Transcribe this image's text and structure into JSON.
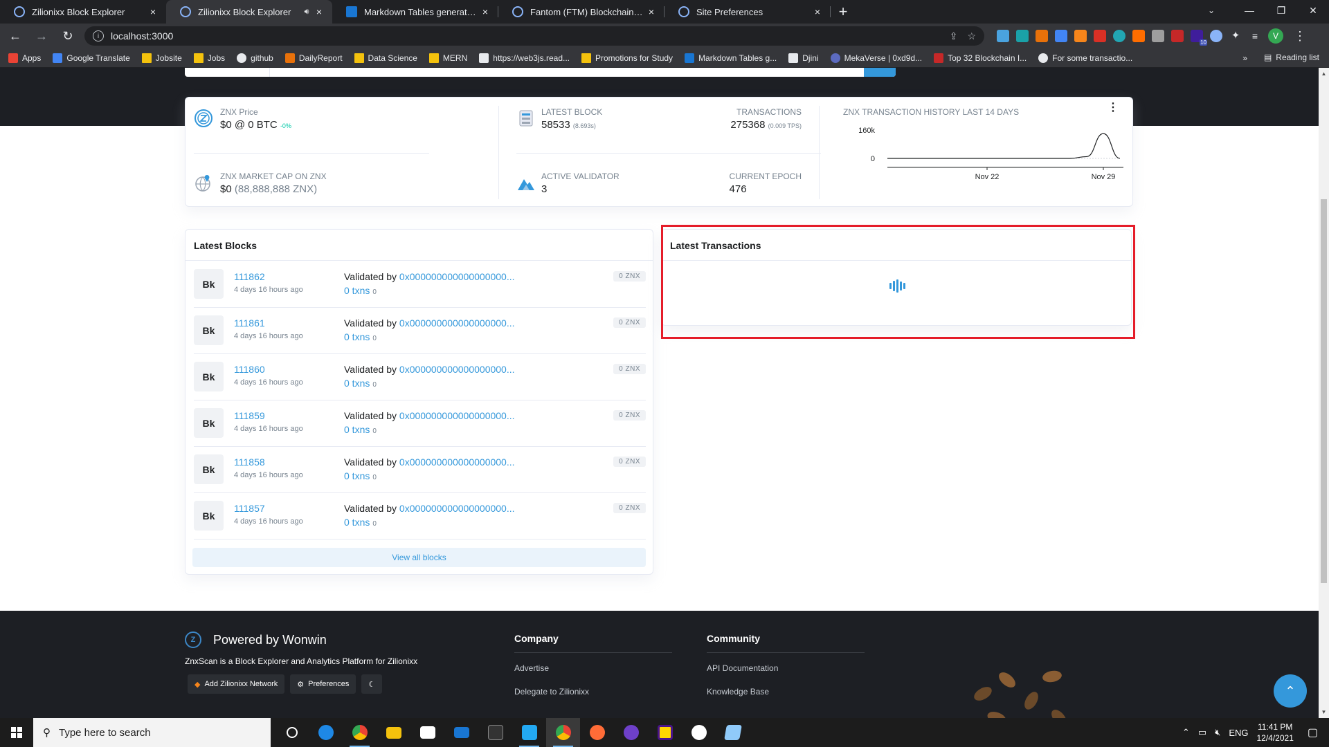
{
  "browser": {
    "tabs": [
      {
        "title": "Zilionixx Block Explorer",
        "active": false,
        "control": "×"
      },
      {
        "title": "Zilionixx Block Explorer",
        "active": true,
        "control": "×"
      },
      {
        "title": "Markdown Tables generator - Tal",
        "active": false,
        "control": "×"
      },
      {
        "title": "Fantom (FTM) Blockchain Explore",
        "active": false,
        "control": "×"
      },
      {
        "title": "Site Preferences",
        "active": false,
        "control": "×"
      }
    ],
    "new_tab": "+",
    "url": "localhost:3000",
    "profile_initial": "V",
    "extension_badge": "10",
    "bookmarks": [
      {
        "label": "Apps",
        "kind": "apps"
      },
      {
        "label": "Google Translate",
        "kind": "translate"
      },
      {
        "label": "Jobsite",
        "kind": "folder"
      },
      {
        "label": "Jobs",
        "kind": "folder"
      },
      {
        "label": "github",
        "kind": "github"
      },
      {
        "label": "DailyReport",
        "kind": "report"
      },
      {
        "label": "Data Science",
        "kind": "folder"
      },
      {
        "label": "MERN",
        "kind": "folder"
      },
      {
        "label": "https://web3js.read...",
        "kind": "doc"
      },
      {
        "label": "Promotions for Study",
        "kind": "folder"
      },
      {
        "label": "Markdown Tables g...",
        "kind": "table"
      },
      {
        "label": "Djini",
        "kind": "djini"
      },
      {
        "label": "MekaVerse | 0xd9d...",
        "kind": "meka"
      },
      {
        "label": "Top 32 Blockchain I...",
        "kind": "shield"
      },
      {
        "label": "For some transactio...",
        "kind": "github"
      }
    ],
    "bookmarks_more": "»",
    "reading_list": "Reading list"
  },
  "stats": {
    "price_label": "ZNX Price",
    "price_value": "$0 @ 0 BTC",
    "price_change": "-0%",
    "marketcap_label": "ZNX MARKET CAP ON ZNX",
    "marketcap_value": "$0",
    "marketcap_sub": "(88,888,888 ZNX)",
    "latest_block_label": "LATEST BLOCK",
    "latest_block_value": "58533",
    "latest_block_time": "(8.693s)",
    "transactions_label": "TRANSACTIONS",
    "transactions_value": "275368",
    "transactions_tps": "(0.009 TPS)",
    "validator_label": "ACTIVE VALIDATOR",
    "validator_value": "3",
    "epoch_label": "CURRENT EPOCH",
    "epoch_value": "476"
  },
  "chart_data": {
    "type": "line",
    "title": "ZNX TRANSACTION HISTORY LAST 14 DAYS",
    "menu_icon": "⋮",
    "y_ticks": [
      "160k",
      "0"
    ],
    "x_ticks": [
      "Nov 22",
      "Nov 29"
    ],
    "x": [
      "Nov 16",
      "Nov 17",
      "Nov 18",
      "Nov 19",
      "Nov 20",
      "Nov 21",
      "Nov 22",
      "Nov 23",
      "Nov 24",
      "Nov 25",
      "Nov 26",
      "Nov 27",
      "Nov 28",
      "Nov 29",
      "Nov 30"
    ],
    "values": [
      0,
      0,
      0,
      0,
      0,
      0,
      0,
      0,
      0,
      0,
      0,
      0,
      10000,
      140000,
      0
    ],
    "ylim": [
      0,
      160000
    ],
    "grid": false,
    "legend": "none"
  },
  "latest_blocks": {
    "title": "Latest Blocks",
    "badge": "Bk",
    "validated_prefix": "Validated by",
    "rows": [
      {
        "number": "111862",
        "age": "4 days 16 hours ago",
        "validator": "0x000000000000000000...",
        "txns": "0 txns",
        "tx_count": "0",
        "amount": "0 ZNX"
      },
      {
        "number": "111861",
        "age": "4 days 16 hours ago",
        "validator": "0x000000000000000000...",
        "txns": "0 txns",
        "tx_count": "0",
        "amount": "0 ZNX"
      },
      {
        "number": "111860",
        "age": "4 days 16 hours ago",
        "validator": "0x000000000000000000...",
        "txns": "0 txns",
        "tx_count": "0",
        "amount": "0 ZNX"
      },
      {
        "number": "111859",
        "age": "4 days 16 hours ago",
        "validator": "0x000000000000000000...",
        "txns": "0 txns",
        "tx_count": "0",
        "amount": "0 ZNX"
      },
      {
        "number": "111858",
        "age": "4 days 16 hours ago",
        "validator": "0x000000000000000000...",
        "txns": "0 txns",
        "tx_count": "0",
        "amount": "0 ZNX"
      },
      {
        "number": "111857",
        "age": "4 days 16 hours ago",
        "validator": "0x000000000000000000...",
        "txns": "0 txns",
        "tx_count": "0",
        "amount": "0 ZNX"
      }
    ],
    "view_all": "View all blocks"
  },
  "latest_transactions": {
    "title": "Latest Transactions",
    "loading": true
  },
  "footer": {
    "logo_letter": "Z",
    "brand": "Powered by Wonwin",
    "description": "ZnxScan is a Block Explorer and Analytics Platform for Zilionixx",
    "buttons": [
      "Add Zilionixx Network",
      "Preferences"
    ],
    "theme_icon": "☾",
    "company_title": "Company",
    "company_links": [
      "Advertise",
      "Delegate to Zilionixx"
    ],
    "community_title": "Community",
    "community_links": [
      "API Documentation",
      "Knowledge Base"
    ],
    "back_to_top": "⌃"
  },
  "taskbar": {
    "search_placeholder": "Type here to search",
    "language": "ENG",
    "time": "11:41 PM",
    "date": "12/4/2021"
  },
  "colors": {
    "accent": "#3498db",
    "dark_bg": "#1d1f24",
    "highlight": "#e51d2a",
    "positive": "#00c9a7"
  }
}
